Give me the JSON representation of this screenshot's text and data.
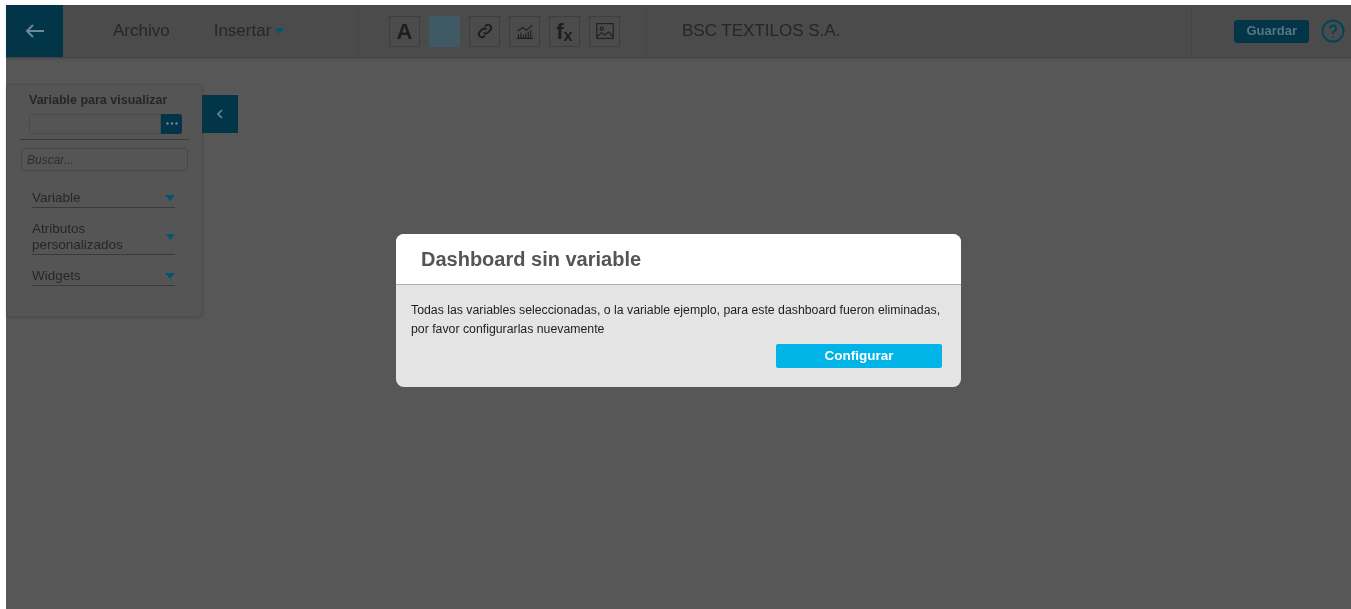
{
  "header": {
    "menus": [
      {
        "label": "Archivo",
        "dropdown": false
      },
      {
        "label": "Insertar",
        "dropdown": true
      }
    ],
    "tools": [
      {
        "kind": "text",
        "label": "A"
      },
      {
        "kind": "color"
      },
      {
        "kind": "link"
      },
      {
        "kind": "chart"
      },
      {
        "kind": "text",
        "label": "f$_{x}$"
      },
      {
        "kind": "image"
      }
    ],
    "title": "BSC TEXTILOS S.A.",
    "save": "Guardar"
  },
  "sidebar": {
    "heading": "Variable para visualizar",
    "search_placeholder": "Buscar...",
    "sections": [
      {
        "label": "Variable"
      },
      {
        "label": "Atributos personalizados"
      },
      {
        "label": "Widgets"
      }
    ]
  },
  "dialog": {
    "title": "Dashboard sin variable",
    "message": "Todas las variables seleccionadas, o la variable ejemplo, para este dashboard fueron eliminadas, por favor configurarlas nuevamente",
    "button": "Configurar"
  }
}
